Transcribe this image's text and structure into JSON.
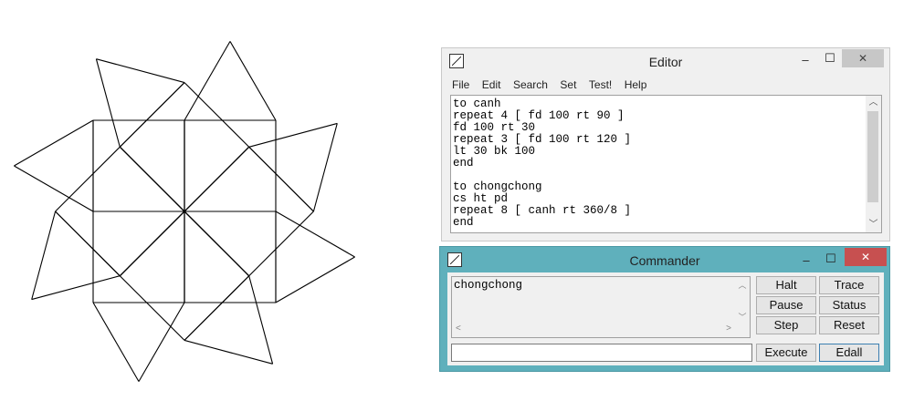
{
  "editor": {
    "title": "Editor",
    "controls": {
      "minimize": "–",
      "maximize": "☐",
      "close": "✕"
    },
    "menu": [
      "File",
      "Edit",
      "Search",
      "Set",
      "Test!",
      "Help"
    ],
    "code": "to canh\nrepeat 4 [ fd 100 rt 90 ]\nfd 100 rt 30\nrepeat 3 [ fd 100 rt 120 ]\nlt 30 bk 100\nend\n\nto chongchong\ncs ht pd\nrepeat 8 [ canh rt 360/8 ]\nend"
  },
  "commander": {
    "title": "Commander",
    "controls": {
      "minimize": "–",
      "maximize": "☐",
      "close": "✕"
    },
    "history": "chongchong",
    "input_value": "",
    "buttons": {
      "halt": "Halt",
      "trace": "Trace",
      "pause": "Pause",
      "status": "Status",
      "step": "Step",
      "reset": "Reset",
      "execute": "Execute",
      "edall": "Edall"
    }
  },
  "turtle_drawing": {
    "procedure": "chongchong",
    "repetitions": 8,
    "turn_degrees": 45,
    "side_length": 100,
    "line_color": "#000000"
  }
}
